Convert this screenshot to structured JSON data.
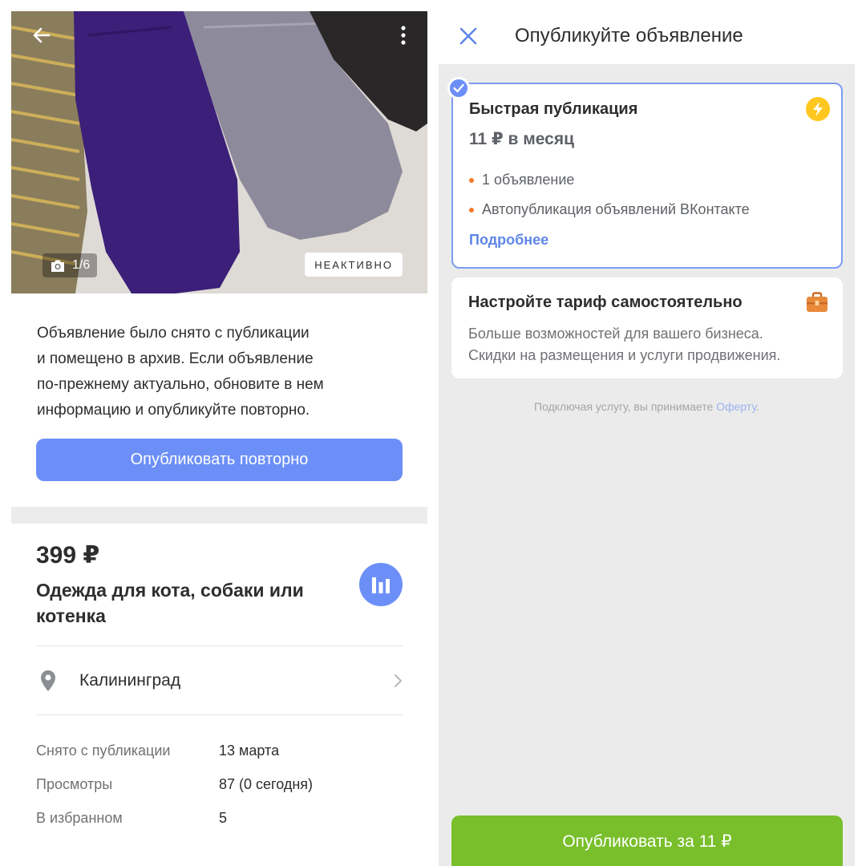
{
  "listing": {
    "photo_counter": "1/6",
    "status_badge": "НЕАКТИВНО",
    "notice_lines": [
      "Объявление было снято с публикации",
      "и помещено в архив. Если объявление",
      "по-прежнему актуально, обновите в нем",
      "информацию и опубликуйте повторно."
    ],
    "republish_label": "Опубликовать повторно",
    "price": "399 ₽",
    "title": "Одежда для кота, собаки или котенка",
    "location": "Калининград",
    "info": [
      {
        "label": "Снято с публикации",
        "value": "13 марта"
      },
      {
        "label": "Просмотры",
        "value": "87 (0 сегодня)"
      },
      {
        "label": "В избранном",
        "value": "5"
      }
    ],
    "icons": {
      "back": "arrow-left-icon",
      "menu": "more-vertical-icon",
      "camera": "camera-icon",
      "stats": "bar-chart-icon",
      "location": "location-pin-icon",
      "chevron": "chevron-right-icon"
    }
  },
  "publish": {
    "title": "Опубликуйте объявление",
    "plan": {
      "name": "Быстрая публикация",
      "price": "11 ₽ в месяц",
      "features": [
        "1 объявление",
        "Автопубликация объявлений ВКонтакте"
      ],
      "more_link": "Подробнее"
    },
    "custom": {
      "title": "Настройте тариф самостоятельно",
      "description_lines": [
        "Больше возможностей для вашего бизнеса.",
        "Скидки на размещения и услуги продвижения."
      ]
    },
    "terms_text": "Подключая услугу, вы принимаете",
    "terms_link": "Оферту",
    "terms_end": ".",
    "pay_button": "Опубликовать за 11 ₽",
    "icons": {
      "close": "close-icon",
      "selected": "check-icon",
      "plan": "lightning-icon",
      "custom": "briefcase-icon"
    }
  },
  "colors": {
    "accent_blue": "#6c8ff7",
    "link_blue": "#5f86e6",
    "pay_green": "#79bf2b",
    "bolt_yellow": "#ffc71f",
    "bullet_orange": "#f47a2a",
    "panel_gray": "#ebebeb"
  }
}
